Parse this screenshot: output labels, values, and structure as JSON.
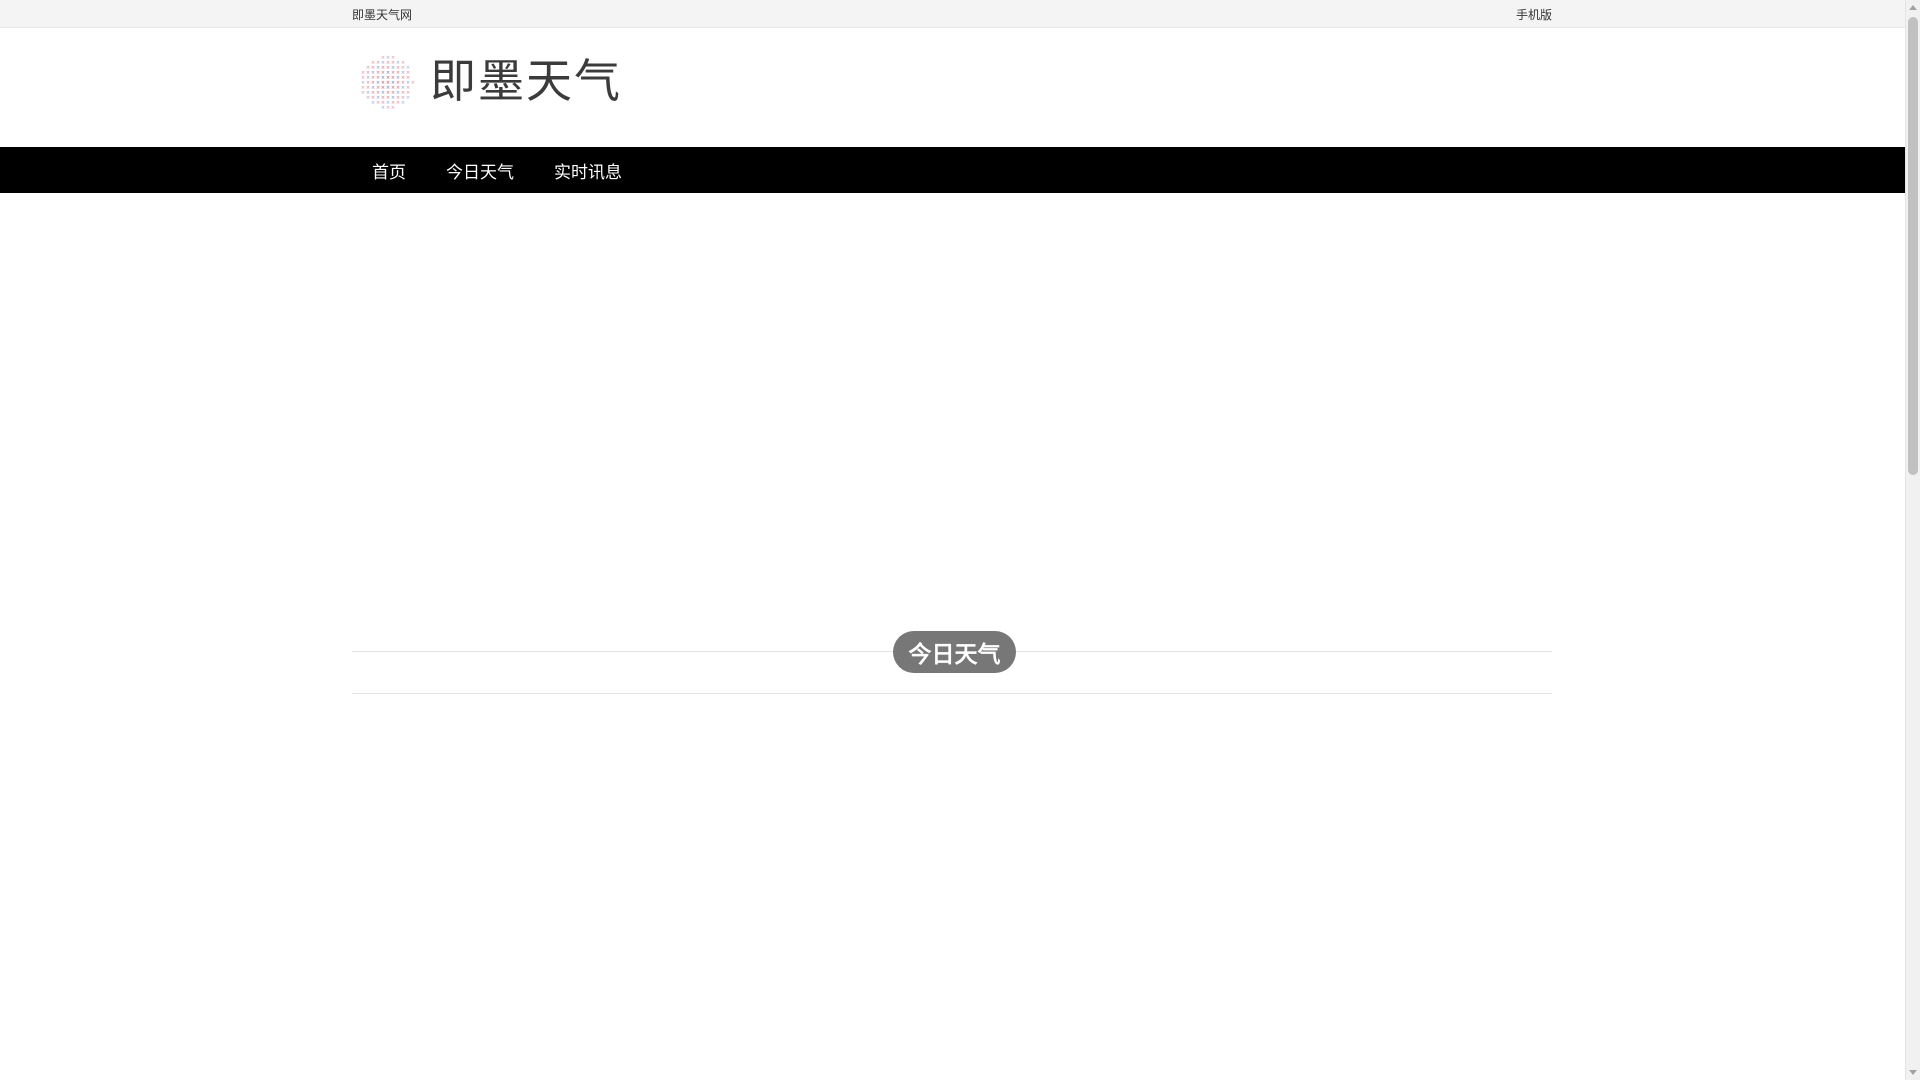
{
  "topbar": {
    "site_name": "即墨天气网",
    "mobile_label": "手机版"
  },
  "header": {
    "logo_text": "即墨天气",
    "logo_icon": "globe-logo-icon"
  },
  "nav": {
    "items": [
      {
        "label": "首页"
      },
      {
        "label": "今日天气"
      },
      {
        "label": "实时讯息"
      }
    ]
  },
  "section": {
    "title": "今日天气"
  },
  "colors": {
    "nav_bg": "#000000",
    "topbar_bg": "#f4f4f4",
    "pill_bg": "#777777",
    "logo_red": "#e0344a",
    "logo_blue": "#2f6fd1"
  }
}
